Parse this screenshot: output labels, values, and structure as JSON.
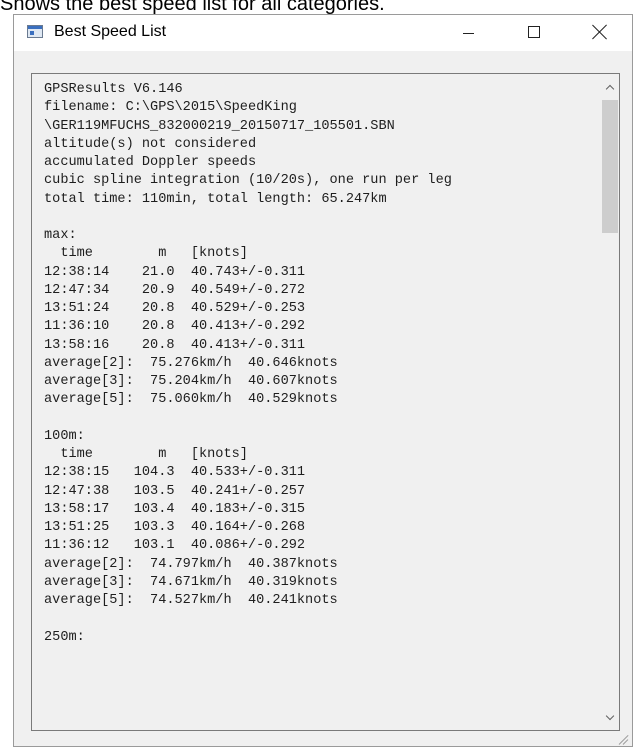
{
  "caption": "Shows the best speed list for all categories.",
  "window": {
    "title": "Best Speed List",
    "buttons": {
      "minimize": "minimize",
      "maximize": "maximize",
      "close": "close"
    }
  },
  "content": {
    "lines": [
      "GPSResults V6.146",
      "filename: C:\\GPS\\2015\\SpeedKing",
      "\\GER119MFUCHS_832000219_20150717_105501.SBN",
      "altitude(s) not considered",
      "accumulated Doppler speeds",
      "cubic spline integration (10/20s), one run per leg",
      "total time: 110min, total length: 65.247km",
      "",
      "max:",
      "  time        m   [knots]",
      "12:38:14    21.0  40.743+/-0.311",
      "12:47:34    20.9  40.549+/-0.272",
      "13:51:24    20.8  40.529+/-0.253",
      "11:36:10    20.8  40.413+/-0.292",
      "13:58:16    20.8  40.413+/-0.311",
      "average[2]:  75.276km/h  40.646knots",
      "average[3]:  75.204km/h  40.607knots",
      "average[5]:  75.060km/h  40.529knots",
      "",
      "100m:",
      "  time        m   [knots]",
      "12:38:15   104.3  40.533+/-0.311",
      "12:47:38   103.5  40.241+/-0.257",
      "13:58:17   103.4  40.183+/-0.315",
      "13:51:25   103.3  40.164+/-0.268",
      "11:36:12   103.1  40.086+/-0.292",
      "average[2]:  74.797km/h  40.387knots",
      "average[3]:  74.671km/h  40.319knots",
      "average[5]:  74.527km/h  40.241knots",
      "",
      "250m:"
    ]
  },
  "scrollbar": {
    "position": 0,
    "visible_fraction": 0.22
  },
  "icons": {
    "app": "app-window-icon",
    "minimize": "minimize-icon",
    "maximize": "maximize-icon",
    "close": "close-icon",
    "scroll_up": "chevron-up-icon",
    "scroll_down": "chevron-down-icon",
    "resize": "resize-grip-icon"
  }
}
